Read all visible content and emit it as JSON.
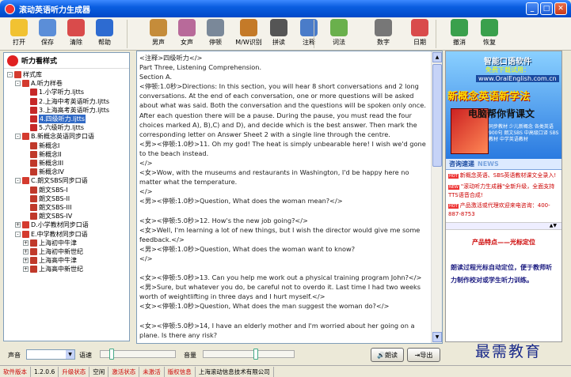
{
  "window": {
    "title": "滚动英语听力生成器"
  },
  "toolbar": {
    "items": [
      {
        "label": "打开",
        "icon": "folder-open-icon",
        "color": "#f1c232"
      },
      {
        "label": "保存",
        "icon": "save-icon",
        "color": "#5b8ed8"
      },
      {
        "label": "清除",
        "icon": "clear-icon",
        "color": "#d94b4b"
      },
      {
        "label": "帮助",
        "icon": "help-icon",
        "color": "#2d6bd1"
      },
      {
        "label": "男声",
        "icon": "male-voice-icon",
        "color": "#c58c3a"
      },
      {
        "label": "女声",
        "icon": "female-voice-icon",
        "color": "#b86a9a"
      },
      {
        "label": "停顿",
        "icon": "pause-clock-icon",
        "color": "#7a8899"
      },
      {
        "label": "M/W识别",
        "icon": "mw-detect-icon",
        "color": "#c47a28"
      },
      {
        "label": "拼读",
        "icon": "spell-icon",
        "color": "#555555"
      },
      {
        "label": "注释",
        "icon": "annotate-icon",
        "color": "#4a7cc9"
      },
      {
        "label": "词法",
        "icon": "lexical-icon",
        "color": "#6ab04c"
      },
      {
        "label": "数字",
        "icon": "number-icon",
        "color": "#777777"
      },
      {
        "label": "日期",
        "icon": "date-icon",
        "color": "#d94b4b"
      },
      {
        "label": "撤消",
        "icon": "undo-icon",
        "color": "#3aa04c"
      },
      {
        "label": "恢复",
        "icon": "redo-icon",
        "color": "#3aa04c"
      }
    ]
  },
  "left_panel": {
    "title": "听力看样式",
    "tree": [
      {
        "text": "样式库",
        "level": 0,
        "exp": "-",
        "icon": "folder"
      },
      {
        "text": "A.听力样卷",
        "level": 1,
        "exp": "-",
        "icon": "folder"
      },
      {
        "text": "1.小学听力.ljtts",
        "level": 2,
        "exp": "",
        "icon": "file"
      },
      {
        "text": "2.上海中考英语听力.ljtts",
        "level": 2,
        "exp": "",
        "icon": "file"
      },
      {
        "text": "3.上海高考英语听力.ljtts",
        "level": 2,
        "exp": "",
        "icon": "file"
      },
      {
        "text": "4.四级听力.ljtts",
        "level": 2,
        "exp": "",
        "icon": "file",
        "selected": true
      },
      {
        "text": "5.六级听力.ljtts",
        "level": 2,
        "exp": "",
        "icon": "file"
      },
      {
        "text": "B.新概念英语同步口语",
        "level": 1,
        "exp": "-",
        "icon": "folder"
      },
      {
        "text": "新概念I",
        "level": 2,
        "exp": "",
        "icon": "book"
      },
      {
        "text": "新概念II",
        "level": 2,
        "exp": "",
        "icon": "book"
      },
      {
        "text": "新概念III",
        "level": 2,
        "exp": "",
        "icon": "book"
      },
      {
        "text": "新概念IV",
        "level": 2,
        "exp": "",
        "icon": "book"
      },
      {
        "text": "C.朗文SBS同步口语",
        "level": 1,
        "exp": "-",
        "icon": "folder"
      },
      {
        "text": "朗文SBS-I",
        "level": 2,
        "exp": "",
        "icon": "book"
      },
      {
        "text": "朗文SBS-II",
        "level": 2,
        "exp": "",
        "icon": "book"
      },
      {
        "text": "朗文SBS-III",
        "level": 2,
        "exp": "",
        "icon": "book"
      },
      {
        "text": "朗文SBS-IV",
        "level": 2,
        "exp": "",
        "icon": "book"
      },
      {
        "text": "D.小学教材同步口语",
        "level": 1,
        "exp": "+",
        "icon": "folder"
      },
      {
        "text": "E.中学教材同步口语",
        "level": 1,
        "exp": "-",
        "icon": "folder"
      },
      {
        "text": "上海初中牛津",
        "level": 2,
        "exp": "+",
        "icon": "book"
      },
      {
        "text": "上海初中新世纪",
        "level": 2,
        "exp": "+",
        "icon": "book"
      },
      {
        "text": "上海高中牛津",
        "level": 2,
        "exp": "+",
        "icon": "book"
      },
      {
        "text": "上海高中新世纪",
        "level": 2,
        "exp": "+",
        "icon": "book"
      }
    ]
  },
  "editor": {
    "text": "<注释>四级听力</>\nPart Three, Listening Comprehension.\nSection A.\n<停顿:1.0秒>Directions: In this section, you will hear 8 short conversations and 2 long conversations. At the end of each conversation, one or more questions will be asked about what was said. Both the conversation and the questions will be spoken only once. After each question there will be a pause. During the pause, you must read the four choices marked A), B),C) and D), and decide which is the best answer. Then mark the corresponding letter on Answer Sheet 2 with a single line through the centre.\n<男><停顿:1.0秒>11. Oh my god! The heat is simply unbearable here! I wish we'd gone to the beach instead.\n</>\n<女>Wow, with the museums and restaurants in Washington, I'd be happy here no matter what the temperature.\n</>\n<男><停顿:1.0秒>Question, What does the woman mean?</>\n\n<女><停顿:5.0秒>12. How's the new job going?</>\n<女>Well, I'm learning a lot of new things, but I wish the director would give me some feedback.</>\n<男><停顿:1.0秒>Question, What does the woman want to know?\n</>\n\n<女><停顿:5.0秒>13. Can you help me work out a physical training program John?</>\n<男>Sure, but whatever you do, be careful not to overdo it. Last time I had two weeks worth of weightlifting in three days and I hurt myself.</>\n<女><停顿:1.0秒>Question, What does the man suggest the woman do?</>\n\n<女><停顿:5.0秒>14, I have an elderly mother and I'm worried about her going on a plane. Is there any risk?"
  },
  "ad": {
    "brand": "智能口语软件",
    "free": "免费下载试用：",
    "url": "www.OralEnglish.com.cn",
    "slogan": "新概念英语新学法",
    "sub": "电脑帮你背课文",
    "tags": "同步教材 少儿新概念 各类英语900句 朗文SBS 中高级口译 SBS教材 中学英语教材",
    "news_title": "咨询速递",
    "news_en": "NEWS",
    "news": [
      {
        "hot": "HOT",
        "text": "新概念英语、SBS英语教材课文全录入!"
      },
      {
        "hot": "NEW",
        "text": "\"滚动听力生成器\"全新升级，全面支持TTS语音合成!"
      },
      {
        "hot": "HOT",
        "text": "产品激活或代理欢迎来电咨询：400-887-8753"
      }
    ],
    "feature_title": "产品特点——光标定位",
    "feature_text": "朗读过程光标自动定位，便于教师听力制作校对或学生听力训练。"
  },
  "controls": {
    "voice_label": "声音",
    "speed_label": "语速",
    "volume_label": "音量",
    "read_button": "朗读",
    "export_button": "导出",
    "speed": 0.12,
    "volume": 0.58
  },
  "status": {
    "version_label": "软件版本",
    "version": "1.2.0.6",
    "upgrade_label": "升级状态",
    "upgrade": "空闲",
    "activate_label": "激活状态",
    "activate": "未激活",
    "copyright_label": "版权信息",
    "company": "上海滚动信息技术有限公司"
  },
  "watermark": "最需教育"
}
